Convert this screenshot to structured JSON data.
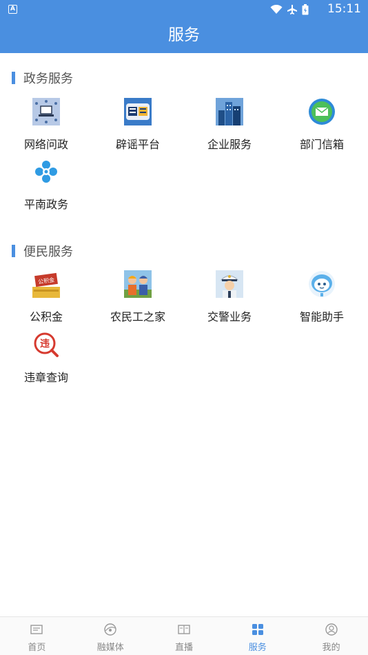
{
  "status_bar": {
    "notification_letter": "A",
    "time": "15:11"
  },
  "header": {
    "title": "服务"
  },
  "sections": [
    {
      "title": "政务服务",
      "items": [
        {
          "label": "网络问政",
          "icon": "network-inquiry-icon"
        },
        {
          "label": "辟谣平台",
          "icon": "rumor-platform-icon"
        },
        {
          "label": "企业服务",
          "icon": "enterprise-service-icon"
        },
        {
          "label": "部门信箱",
          "icon": "department-mailbox-icon"
        },
        {
          "label": "平南政务",
          "icon": "pingnan-government-icon"
        }
      ]
    },
    {
      "title": "便民服务",
      "items": [
        {
          "label": "公积金",
          "icon": "provident-fund-icon",
          "icon_text": "公积金"
        },
        {
          "label": "农民工之家",
          "icon": "migrant-workers-icon"
        },
        {
          "label": "交警业务",
          "icon": "traffic-police-icon"
        },
        {
          "label": "智能助手",
          "icon": "smart-assistant-icon"
        },
        {
          "label": "违章查询",
          "icon": "violation-query-icon",
          "icon_text": "违"
        }
      ]
    }
  ],
  "tabbar": {
    "active": "服务",
    "items": [
      {
        "label": "首页",
        "icon": "home-icon"
      },
      {
        "label": "融媒体",
        "icon": "media-icon"
      },
      {
        "label": "直播",
        "icon": "live-icon"
      },
      {
        "label": "服务",
        "icon": "service-grid-icon"
      },
      {
        "label": "我的",
        "icon": "profile-icon"
      }
    ]
  },
  "colors": {
    "accent": "#4a8fe0",
    "text": "#222222",
    "muted": "#888888"
  }
}
